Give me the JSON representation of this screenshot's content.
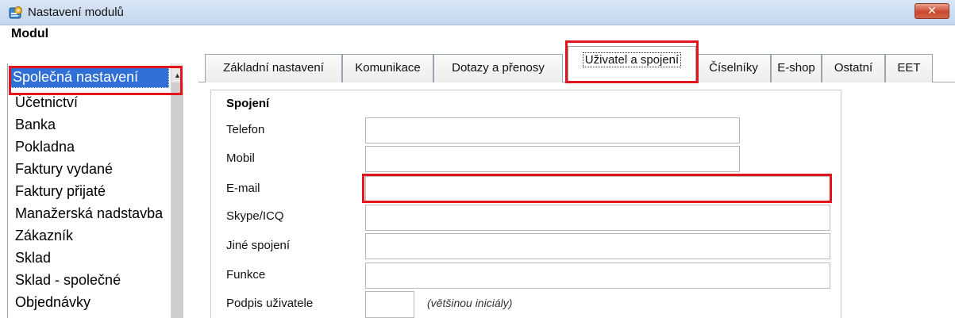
{
  "window": {
    "title": "Nastavení modulů",
    "close_glyph": "✕",
    "icon": "settings-app-icon"
  },
  "sidebar": {
    "heading": "Modul",
    "items": [
      {
        "label": "Společná nastavení",
        "selected": true
      },
      {
        "label": "Účetnictví"
      },
      {
        "label": "Banka"
      },
      {
        "label": "Pokladna"
      },
      {
        "label": "Faktury vydané"
      },
      {
        "label": "Faktury přijaté"
      },
      {
        "label": "Manažerská nadstavba"
      },
      {
        "label": "Zákazník"
      },
      {
        "label": "Sklad"
      },
      {
        "label": "Sklad - společné"
      },
      {
        "label": "Objednávky"
      }
    ]
  },
  "tabs": [
    {
      "label": "Základní nastavení"
    },
    {
      "label": "Komunikace"
    },
    {
      "label": "Dotazy a přenosy"
    },
    {
      "label": "Uživatel a spojení",
      "active": true
    },
    {
      "label": "Číselníky"
    },
    {
      "label": "E-shop"
    },
    {
      "label": "Ostatní"
    },
    {
      "label": "EET"
    }
  ],
  "form": {
    "section_title": "Spojení",
    "fields": [
      {
        "label": "Telefon",
        "value": ""
      },
      {
        "label": "Mobil",
        "value": ""
      },
      {
        "label": "E-mail",
        "value": ""
      },
      {
        "label": "Skype/ICQ",
        "value": ""
      },
      {
        "label": "Jiné spojení",
        "value": ""
      },
      {
        "label": "Funkce",
        "value": ""
      },
      {
        "label": "Podpis uživatele",
        "value": ""
      }
    ],
    "signature_hint": "(většinou iniciály)"
  },
  "highlight_color": "#e2141d",
  "selection_color": "#2f6fd6"
}
